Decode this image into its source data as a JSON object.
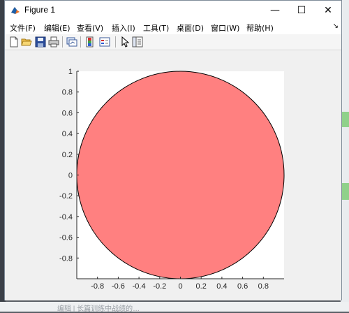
{
  "window": {
    "title": "Figure 1",
    "minimize_glyph": "—",
    "maximize_glyph": "☐",
    "close_glyph": "✕"
  },
  "menu": {
    "items": [
      {
        "label": "文件(F)"
      },
      {
        "label": "编辑(E)"
      },
      {
        "label": "查看(V)"
      },
      {
        "label": "插入(I)"
      },
      {
        "label": "工具(T)"
      },
      {
        "label": "桌面(D)"
      },
      {
        "label": "窗口(W)"
      },
      {
        "label": "帮助(H)"
      }
    ],
    "overflow_glyph": "↘"
  },
  "toolbar": {
    "buttons": [
      {
        "icon": "new-figure-icon"
      },
      {
        "icon": "open-file-icon"
      },
      {
        "icon": "save-icon"
      },
      {
        "icon": "print-icon"
      },
      {
        "icon": "link-plot-icon"
      },
      {
        "icon": "insert-colorbar-icon"
      },
      {
        "icon": "insert-legend-icon"
      },
      {
        "icon": "edit-plot-pointer-icon"
      },
      {
        "icon": "property-inspector-icon"
      }
    ]
  },
  "background": {
    "bottom_text": "编辑 | 长篇训练中战绩的…"
  },
  "chart_data": {
    "type": "area",
    "title": "",
    "xlabel": "",
    "ylabel": "",
    "xlim": [
      -1,
      1
    ],
    "ylim": [
      -1,
      1
    ],
    "x_ticks": [
      -0.8,
      -0.6,
      -0.4,
      -0.2,
      0,
      0.2,
      0.4,
      0.6,
      0.8
    ],
    "y_ticks": [
      -0.8,
      -0.6,
      -0.4,
      -0.2,
      0,
      0.2,
      0.4,
      0.6,
      0.8,
      1
    ],
    "x_tick_labels": [
      "-0.8",
      "-0.6",
      "-0.4",
      "-0.2",
      "0",
      "0.2",
      "0.4",
      "0.6",
      "0.8"
    ],
    "y_tick_labels": [
      "-0.8",
      "-0.6",
      "-0.4",
      "-0.2",
      "0",
      "0.2",
      "0.4",
      "0.6",
      "0.8",
      "1"
    ],
    "grid": false,
    "series": [
      {
        "shape": "circle",
        "center": [
          0,
          0
        ],
        "radius": 1,
        "fill_color": "#ff8080",
        "edge_color": "#000000"
      }
    ]
  }
}
